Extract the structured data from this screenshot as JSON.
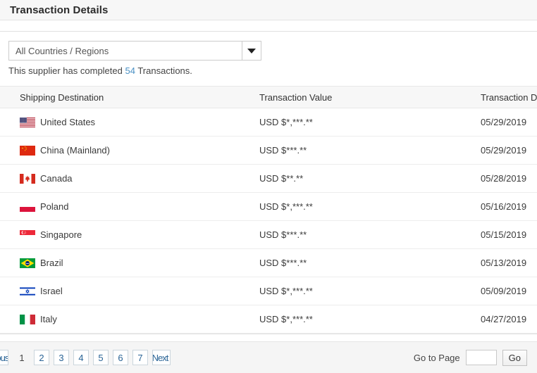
{
  "header": {
    "title": "Transaction Details"
  },
  "filter": {
    "selected": "All Countries / Regions",
    "caret_icon": "chevron-down-icon"
  },
  "summary": {
    "prefix": "This supplier has completed",
    "count": "54",
    "suffix": "Transactions."
  },
  "table": {
    "columns": [
      "Shipping Destination",
      "Transaction Value",
      "Transaction Date"
    ],
    "rows": [
      {
        "flag": "us",
        "destination": "United States",
        "value": "USD $*,***.**",
        "date": "05/29/2019"
      },
      {
        "flag": "cn",
        "destination": "China (Mainland)",
        "value": "USD $***.**",
        "date": "05/29/2019"
      },
      {
        "flag": "ca",
        "destination": "Canada",
        "value": "USD $**.**",
        "date": "05/28/2019"
      },
      {
        "flag": "pl",
        "destination": "Poland",
        "value": "USD $*,***.**",
        "date": "05/16/2019"
      },
      {
        "flag": "sg",
        "destination": "Singapore",
        "value": "USD $***.**",
        "date": "05/15/2019"
      },
      {
        "flag": "br",
        "destination": "Brazil",
        "value": "USD $***.**",
        "date": "05/13/2019"
      },
      {
        "flag": "il",
        "destination": "Israel",
        "value": "USD $*,***.**",
        "date": "05/09/2019"
      },
      {
        "flag": "it",
        "destination": "Italy",
        "value": "USD $*,***.**",
        "date": "04/27/2019"
      }
    ]
  },
  "pagination": {
    "previous_label": "Previous",
    "next_label": "Next",
    "current_page": "1",
    "pages": [
      "2",
      "3",
      "4",
      "5",
      "6",
      "7"
    ],
    "goto_label": "Go to Page",
    "goto_value": "",
    "goto_placeholder": "",
    "go_label": "Go"
  },
  "colors": {
    "link": "#4a90c4",
    "page_link": "#2a6496",
    "header_bg": "#f7f7f7",
    "footer_bg": "#f5f5f5"
  }
}
